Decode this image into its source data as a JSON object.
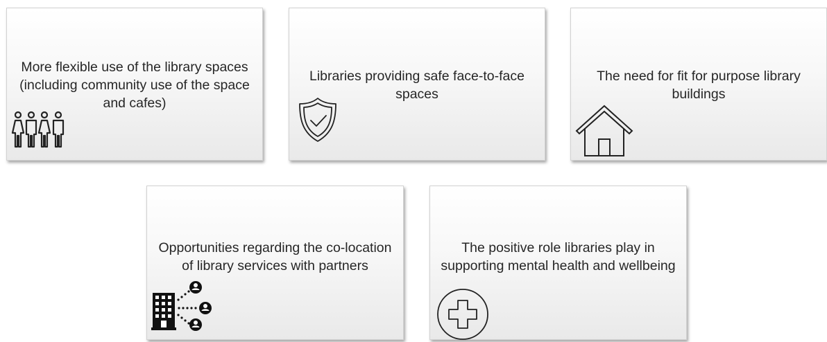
{
  "cards": [
    {
      "text": "More flexible use of the library spaces (including community use of the space and cafes)",
      "icon": "people-group-icon"
    },
    {
      "text": "Libraries providing safe face-to-face spaces",
      "icon": "shield-check-icon"
    },
    {
      "text": "The need for fit for purpose library buildings",
      "icon": "house-icon"
    },
    {
      "text": "Opportunities regarding the co-location of library services with partners",
      "icon": "building-network-icon"
    },
    {
      "text": "The positive role libraries play in supporting mental health and wellbeing",
      "icon": "medical-cross-icon"
    }
  ]
}
